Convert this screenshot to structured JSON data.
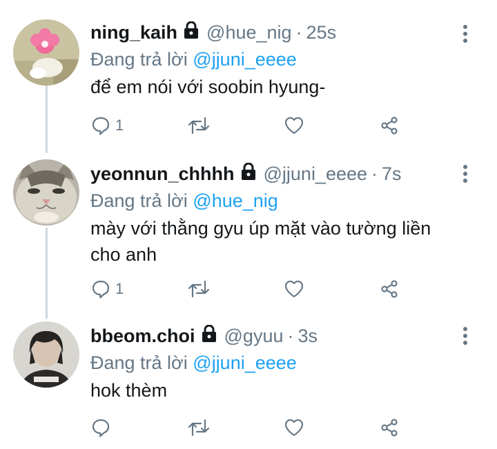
{
  "reply_prefix": "Đang trả lời",
  "tweets": [
    {
      "name": "ning_kaih",
      "handle": "@hue_nig",
      "separator": "·",
      "time": "25s",
      "reply_to": "@jjuni_eeee",
      "text": "để em nói với soobin hyung-",
      "reply_count": "1",
      "avatar": "pink-cartoon-avatar"
    },
    {
      "name": "yeonnun_chhhh",
      "handle": "@jjuni_eeee",
      "separator": "·",
      "time": "7s",
      "reply_to": "@hue_nig",
      "text": "mày với thằng gyu úp mặt vào tường liền cho anh",
      "reply_count": "1",
      "avatar": "cat-face-avatar"
    },
    {
      "name": "bbeom.choi",
      "handle": "@gyuu",
      "separator": "·",
      "time": "3s",
      "reply_to": "@jjuni_eeee",
      "text": "hok thèm",
      "reply_count": "",
      "avatar": "person-photo-avatar"
    }
  ],
  "colors": {
    "text": "#14171a",
    "muted": "#657786",
    "link": "#1da1f2",
    "thread": "#cfd9de"
  }
}
